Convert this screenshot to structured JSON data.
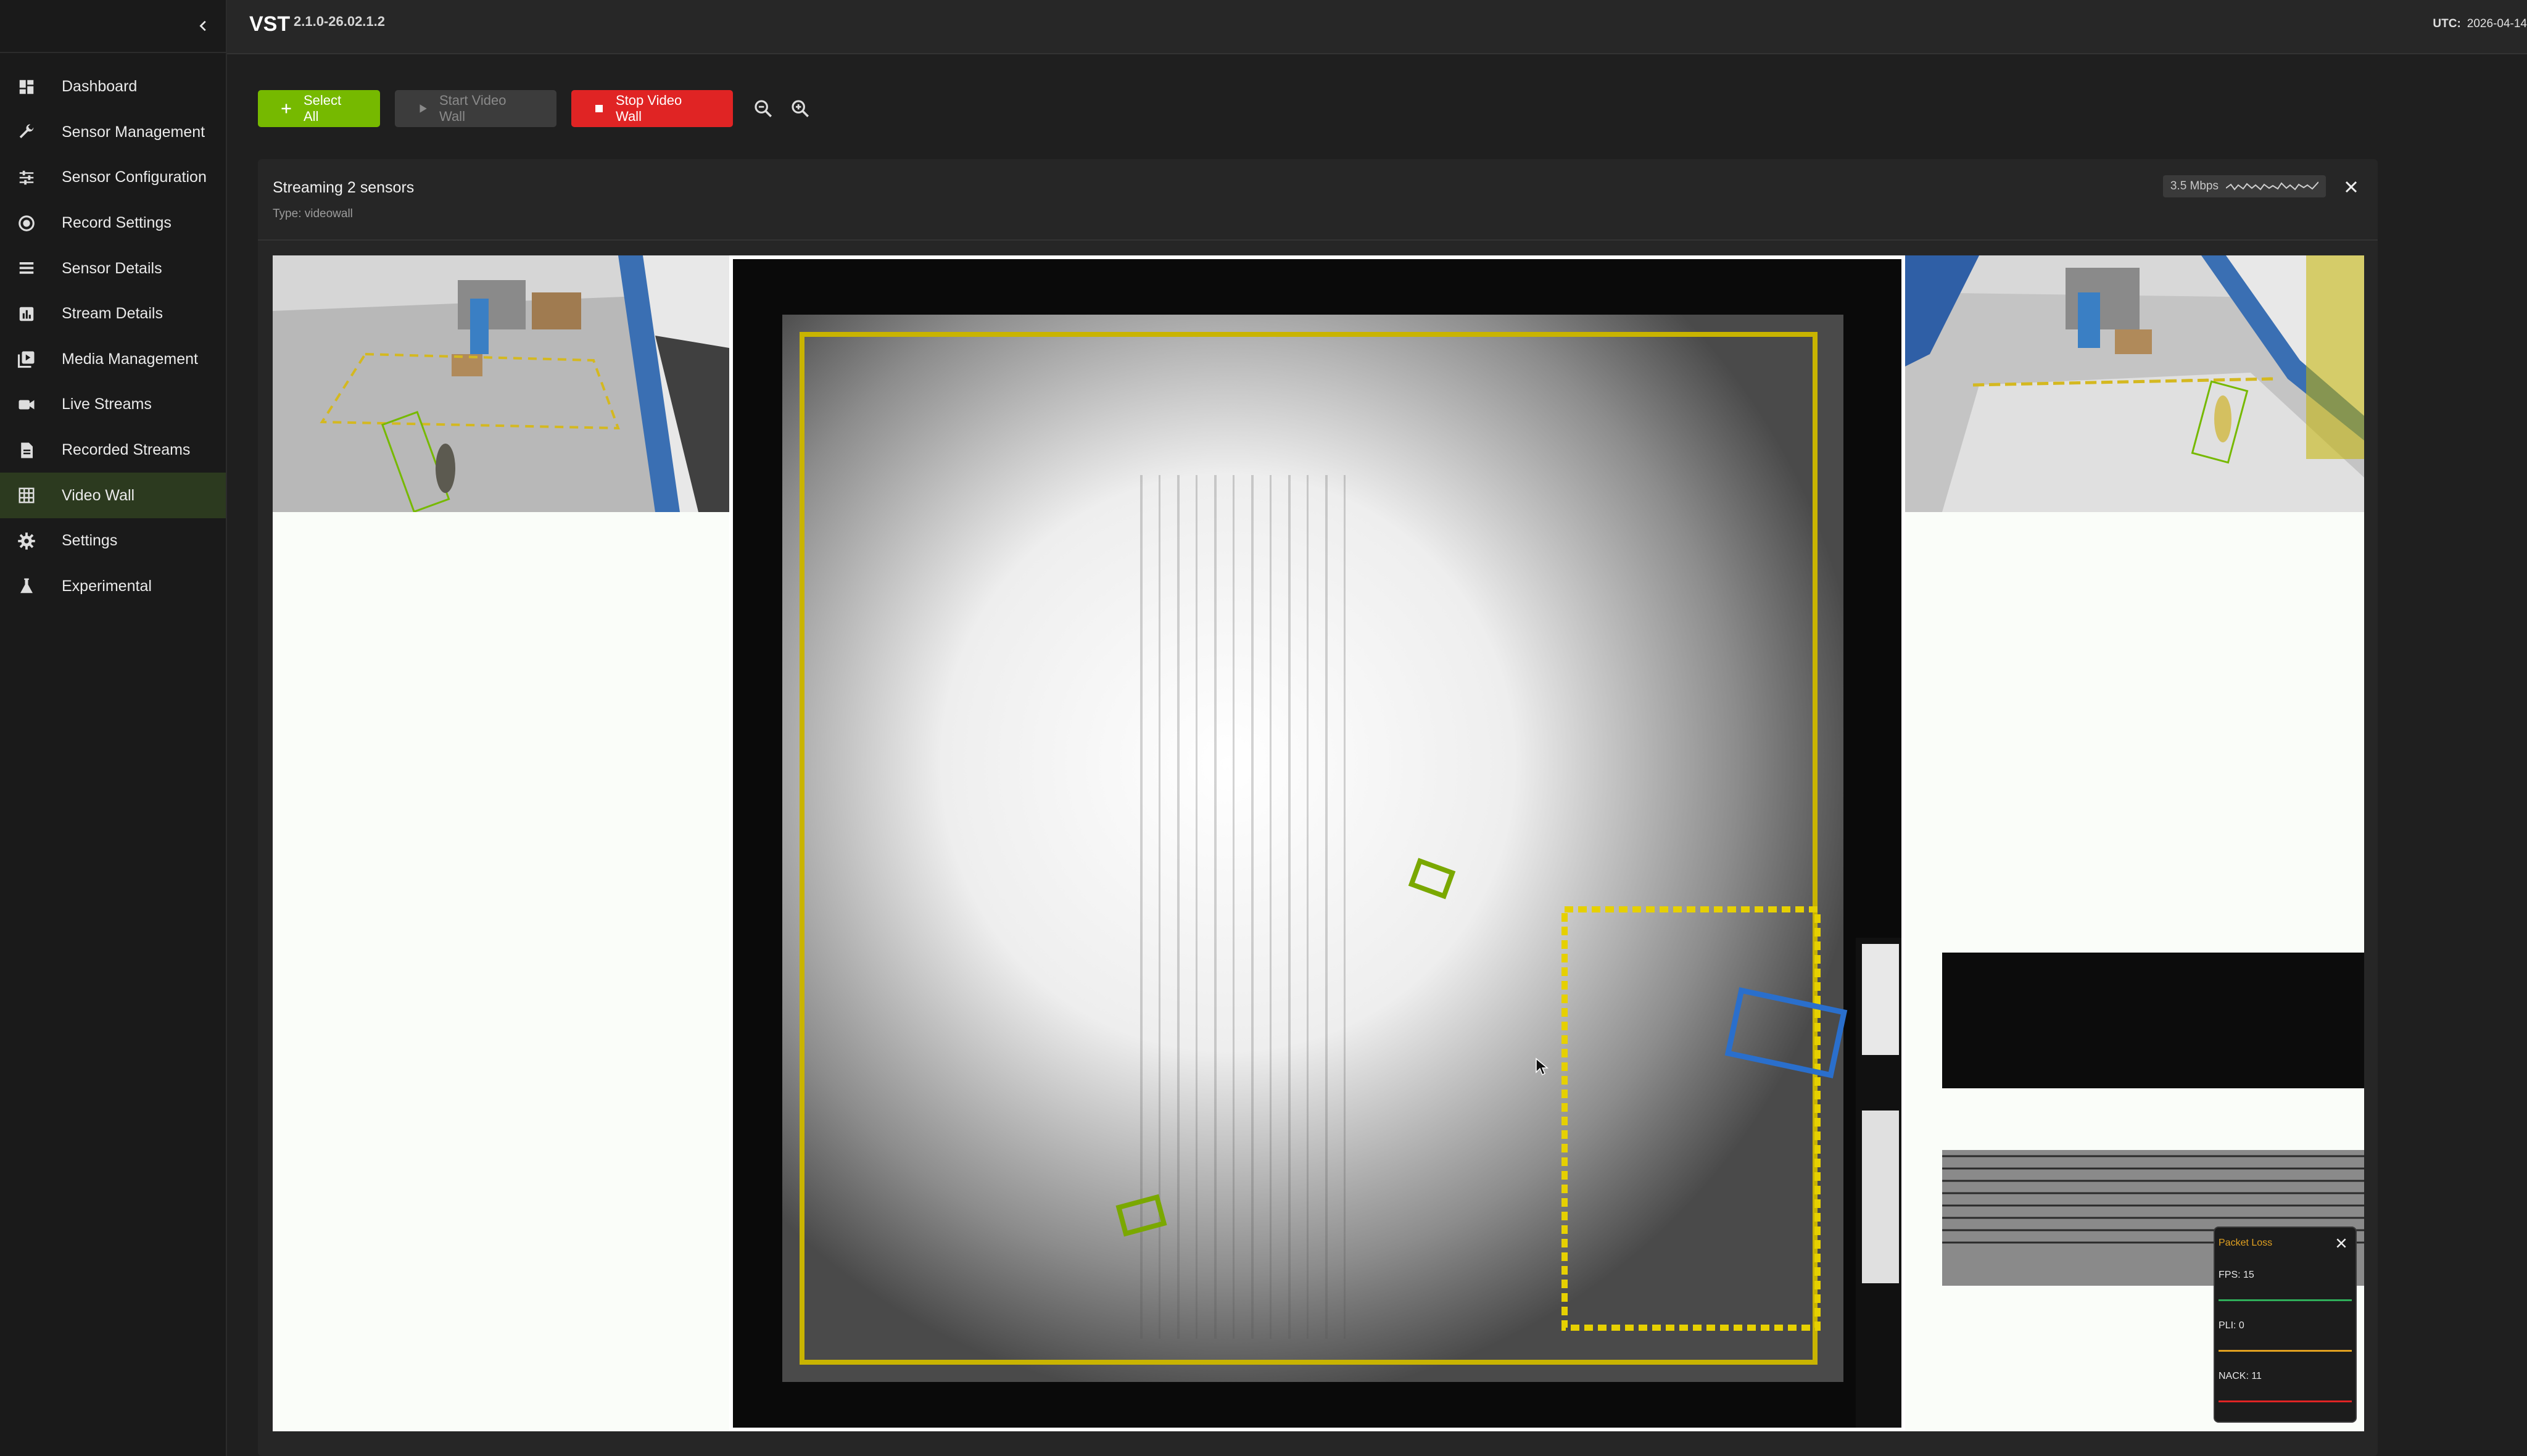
{
  "header": {
    "brand": "VST",
    "version": "2.1.0-26.02.1.2",
    "utc_label": "UTC:",
    "utc_value": "2026-04-14"
  },
  "sidebar": {
    "items": [
      {
        "label": "Dashboard",
        "icon": "dashboard-icon",
        "active": false
      },
      {
        "label": "Sensor Management",
        "icon": "wrench-icon",
        "active": false
      },
      {
        "label": "Sensor Configuration",
        "icon": "sliders-icon",
        "active": false
      },
      {
        "label": "Record Settings",
        "icon": "record-icon",
        "active": false
      },
      {
        "label": "Sensor Details",
        "icon": "list-icon",
        "active": false
      },
      {
        "label": "Stream Details",
        "icon": "bar-chart-icon",
        "active": false
      },
      {
        "label": "Media Management",
        "icon": "media-icon",
        "active": false
      },
      {
        "label": "Live Streams",
        "icon": "camera-icon",
        "active": false
      },
      {
        "label": "Recorded Streams",
        "icon": "file-icon",
        "active": false
      },
      {
        "label": "Video Wall",
        "icon": "grid-icon",
        "active": true
      },
      {
        "label": "Settings",
        "icon": "gear-icon",
        "active": false
      },
      {
        "label": "Experimental",
        "icon": "flask-icon",
        "active": false
      }
    ]
  },
  "toolbar": {
    "select_all": "Select All",
    "start_wall": "Start Video Wall",
    "stop_wall": "Stop Video Wall"
  },
  "panel": {
    "title": "Streaming 2 sensors",
    "type": "Type: videowall",
    "bitrate": "3.5 Mbps"
  },
  "stats": {
    "title": "Packet Loss",
    "fps": "FPS: 15",
    "pli": "PLI: 0",
    "nack": "NACK: 11"
  },
  "colors": {
    "accent_green": "#76b900",
    "stop_red": "#e02424",
    "active_nav": "#2c3a1f",
    "stats_orange": "#e0a020"
  }
}
